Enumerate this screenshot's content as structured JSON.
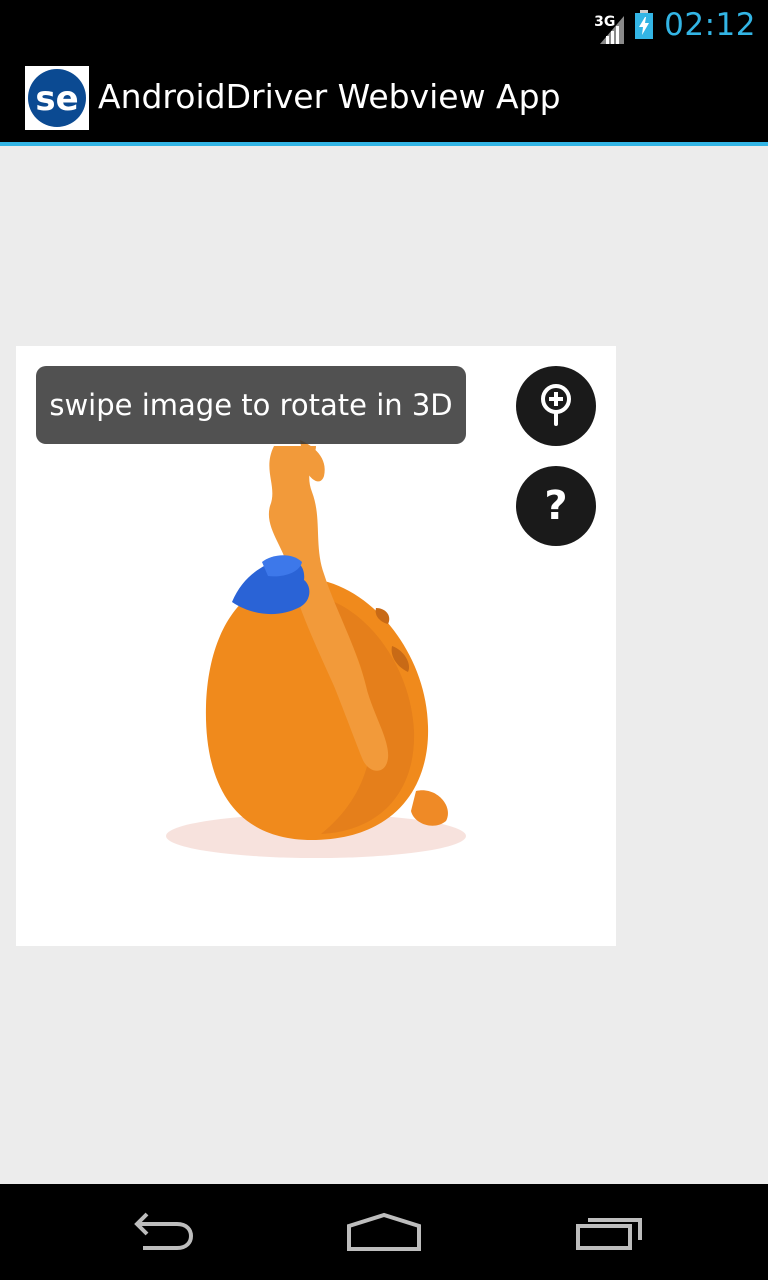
{
  "status_bar": {
    "network_type": "3G",
    "time": "02:12",
    "signal_icon": "signal-icon",
    "battery_icon": "battery-charging-icon"
  },
  "action_bar": {
    "logo_icon": "se-logo-icon",
    "logo_text": "se",
    "title": "AndroidDriver Webview App"
  },
  "viewer": {
    "image": "orange-plush-toy-image",
    "tooltip": "swipe image to rotate in 3D",
    "zoom_icon": "zoom-in-icon",
    "help_label": "?"
  },
  "nav_bar": {
    "back_icon": "back-icon",
    "home_icon": "home-icon",
    "recent_icon": "recent-apps-icon"
  },
  "colors": {
    "accent": "#33b5e5",
    "background": "#ececec",
    "bar": "#000000",
    "logo_blue": "#0b4a92",
    "toy_orange": "#f08a1c",
    "hat_blue": "#2a63d6"
  }
}
